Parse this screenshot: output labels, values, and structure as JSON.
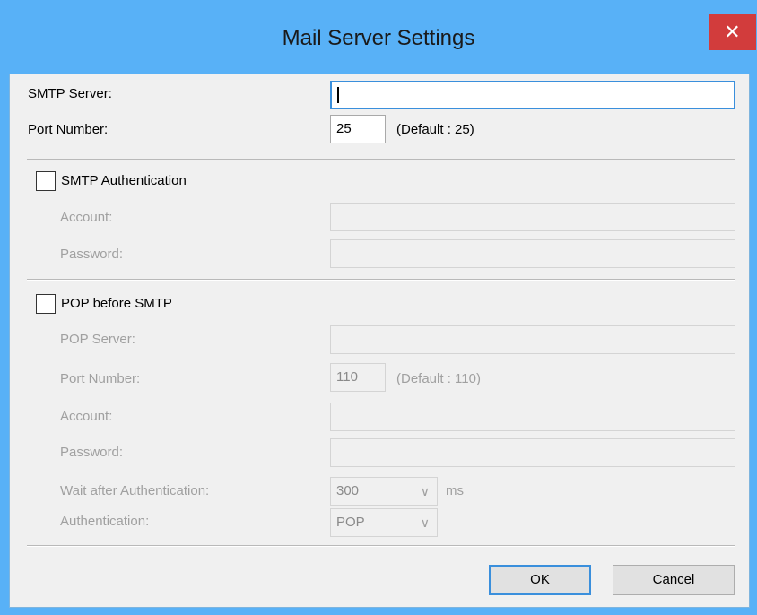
{
  "window": {
    "title": "Mail Server Settings",
    "close_glyph": "✕"
  },
  "smtp": {
    "server_label": "SMTP Server:",
    "server_value": "",
    "port_label": "Port Number:",
    "port_value": "25",
    "port_default": "(Default : 25)"
  },
  "auth": {
    "checkbox_label": "SMTP Authentication",
    "checked": false,
    "account_label": "Account:",
    "account_value": "",
    "password_label": "Password:",
    "password_value": ""
  },
  "pop": {
    "checkbox_label": "POP before SMTP",
    "checked": false,
    "server_label": "POP Server:",
    "server_value": "",
    "port_label": "Port Number:",
    "port_value": "110",
    "port_default": "(Default : 110)",
    "account_label": "Account:",
    "account_value": "",
    "password_label": "Password:",
    "password_value": "",
    "wait_label": "Wait after Authentication:",
    "wait_value": "300",
    "wait_unit": "ms",
    "auth_label": "Authentication:",
    "auth_value": "POP"
  },
  "buttons": {
    "ok": "OK",
    "cancel": "Cancel"
  },
  "icons": {
    "chevron": "chevron-down-icon",
    "close": "close-icon"
  }
}
